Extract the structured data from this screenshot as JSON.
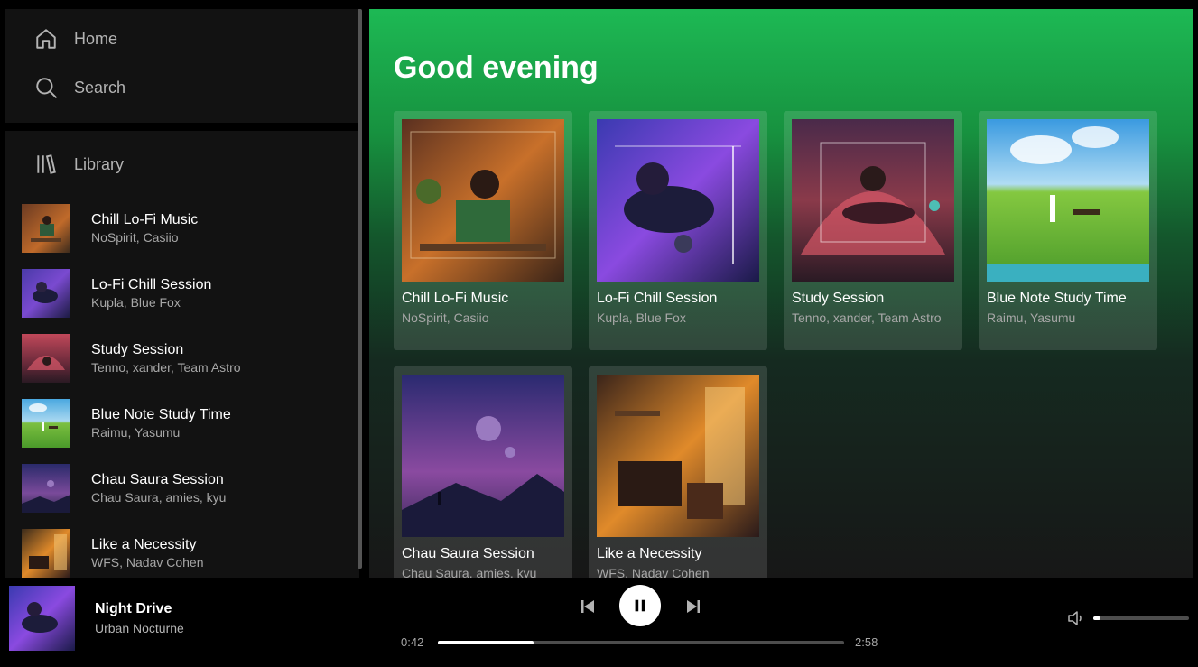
{
  "sidebar": {
    "nav": {
      "home_label": "Home",
      "search_label": "Search"
    },
    "library_label": "Library",
    "items": [
      {
        "title": "Chill Lo-Fi Music",
        "artists": "NoSpirit, Casiio"
      },
      {
        "title": "Lo-Fi Chill Session",
        "artists": "Kupla, Blue Fox"
      },
      {
        "title": "Study Session",
        "artists": "Tenno, xander, Team Astro"
      },
      {
        "title": "Blue Note Study Time",
        "artists": "Raimu, Yasumu"
      },
      {
        "title": "Chau Saura Session",
        "artists": "Chau Saura, amies, kyu"
      },
      {
        "title": "Like a Necessity",
        "artists": "WFS, Nadav Cohen"
      }
    ]
  },
  "main": {
    "greeting": "Good evening",
    "cards": [
      {
        "title": "Chill Lo-Fi Music",
        "artists": "NoSpirit, Casiio"
      },
      {
        "title": "Lo-Fi Chill Session",
        "artists": "Kupla, Blue Fox"
      },
      {
        "title": "Study Session",
        "artists": "Tenno, xander, Team Astro"
      },
      {
        "title": "Blue Note Study Time",
        "artists": "Raimu, Yasumu"
      },
      {
        "title": "Chau Saura Session",
        "artists": "Chau Saura, amies, kyu"
      },
      {
        "title": "Like a Necessity",
        "artists": "WFS, Nadav Cohen"
      }
    ]
  },
  "player": {
    "title": "Night Drive",
    "artist": "Urban Nocturne",
    "current_time": "0:42",
    "duration": "2:58",
    "progress_fraction": 0.236,
    "volume_fraction": 0.08
  },
  "colors": {
    "accent": "#1db954",
    "background": "#000000",
    "panel": "#121212"
  }
}
